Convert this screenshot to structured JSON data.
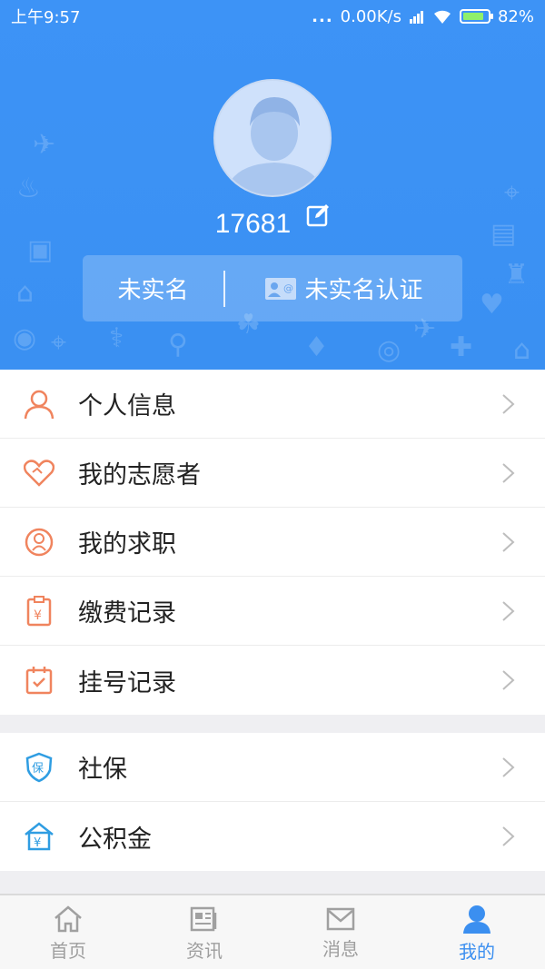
{
  "status": {
    "time": "上午9:57",
    "dots": "...",
    "speed": "0.00K/s",
    "battery": "82%"
  },
  "profile": {
    "username": "17681",
    "auth_status": "未实名",
    "auth_action": "未实名认证"
  },
  "menu_group_1": [
    {
      "label": "个人信息",
      "icon": "person-icon"
    },
    {
      "label": "我的志愿者",
      "icon": "heart-icon"
    },
    {
      "label": "我的求职",
      "icon": "job-icon"
    },
    {
      "label": "缴费记录",
      "icon": "payment-icon"
    },
    {
      "label": "挂号记录",
      "icon": "calendar-icon"
    }
  ],
  "menu_group_2": [
    {
      "label": "社保",
      "icon": "shield-icon"
    },
    {
      "label": "公积金",
      "icon": "house-fund-icon"
    }
  ],
  "tabs": [
    {
      "label": "首页",
      "icon": "home-icon",
      "active": false
    },
    {
      "label": "资讯",
      "icon": "news-icon",
      "active": false
    },
    {
      "label": "消息",
      "icon": "mail-icon",
      "active": false
    },
    {
      "label": "我的",
      "icon": "user-icon",
      "active": true
    }
  ],
  "colors": {
    "header_blue": "#3d93f6",
    "accent_blue": "#3b8ff0",
    "icon_orange": "#f0845e",
    "icon_blue": "#2f9de2"
  }
}
